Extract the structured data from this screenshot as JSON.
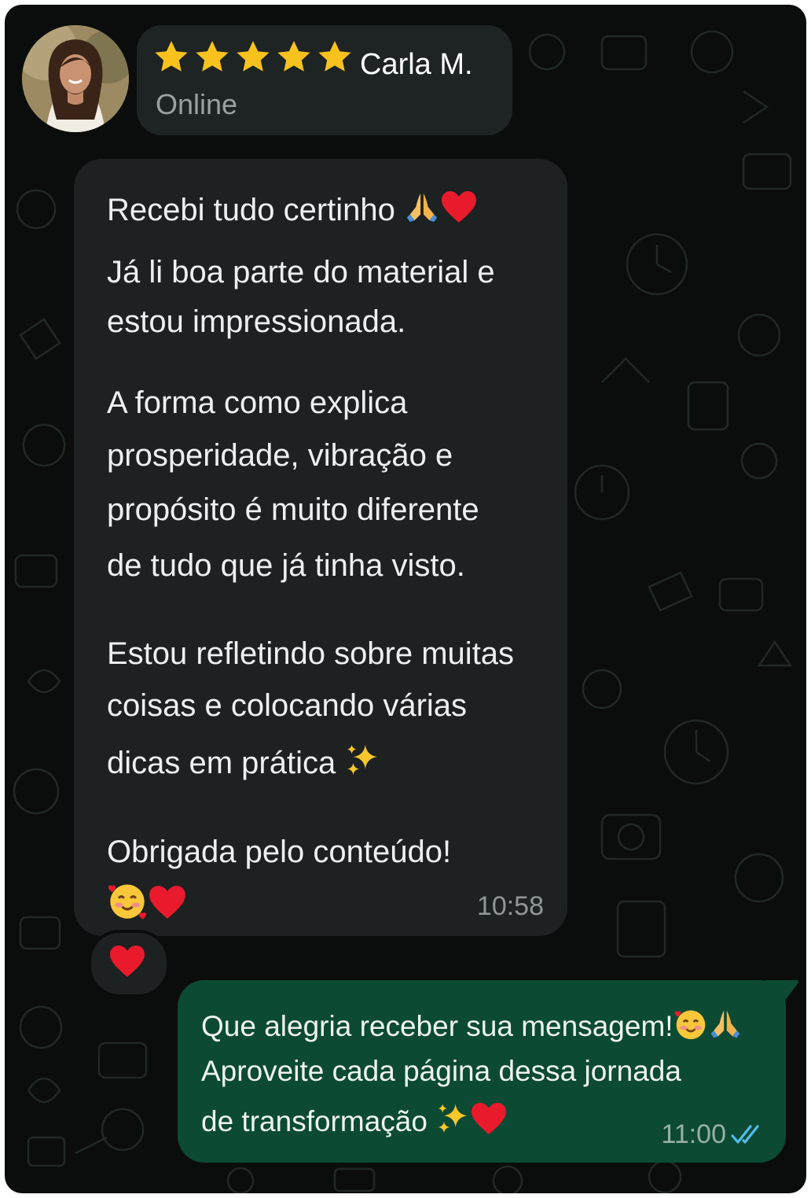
{
  "header": {
    "rating": 5,
    "contact_name": "Carla M.",
    "status": "Online"
  },
  "incoming": {
    "lines": [
      "Recebi tudo certinho",
      "Já li boa parte do material e",
      "estou impressionada.",
      "A forma como explica",
      "prosperidade, vibração e",
      "propósito é muito diferente",
      "de tudo que já tinha visto.",
      "Estou refletindo sobre muitas",
      "coisas e colocando várias",
      "dicas em prática",
      "Obrigada pelo conteúdo!"
    ],
    "time": "10:58",
    "reaction": "heart"
  },
  "outgoing": {
    "lines": [
      "Que alegria receber sua mensagem!",
      "Aproveite cada página dessa jornada",
      "de transformação"
    ],
    "time": "11:00",
    "read_status": "read"
  },
  "colors": {
    "background": "#0b0d0c",
    "incoming_bubble": "#1d2121",
    "outgoing_bubble": "#0c4a33",
    "star": "#f7c21d",
    "read_check": "#53bdeb"
  }
}
